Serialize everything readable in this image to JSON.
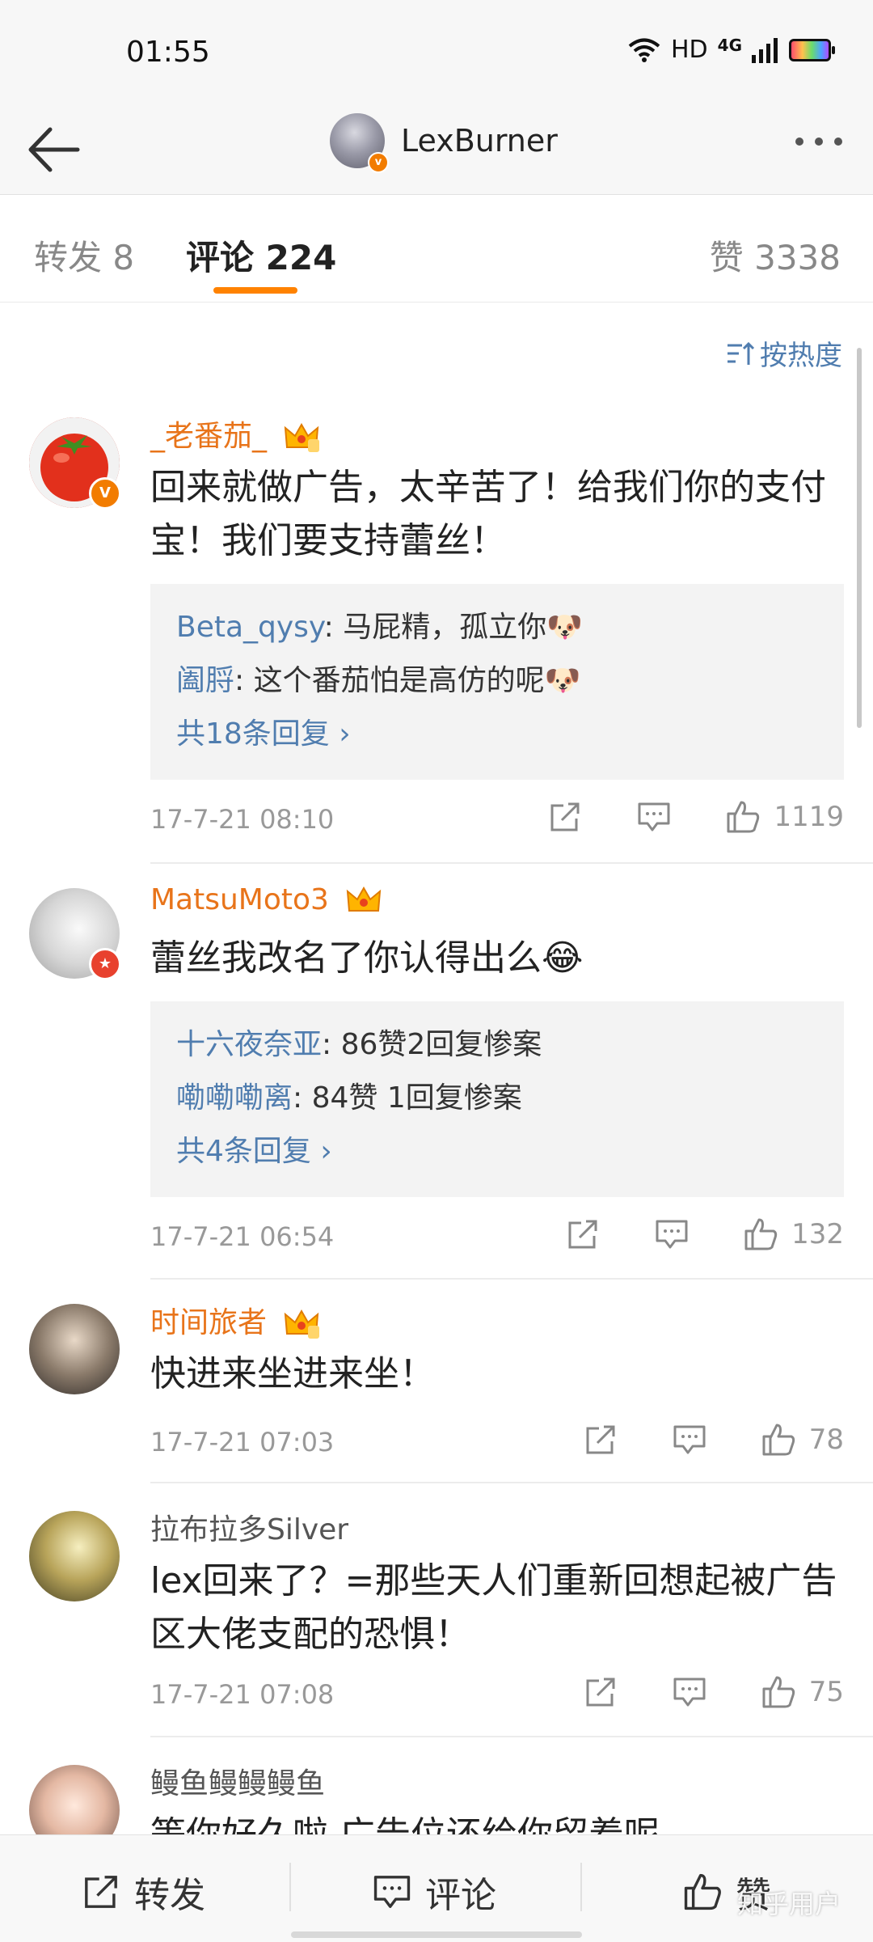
{
  "status_bar": {
    "time": "01:55",
    "hd": "HD",
    "network": "4G"
  },
  "header": {
    "title": "LexBurner",
    "verified": "v"
  },
  "tabs": {
    "repost": "转发 8",
    "comments": "评论 224",
    "likes": "赞 3338"
  },
  "sort_label": "按热度",
  "comments": [
    {
      "user": "_老番茄_",
      "text_line1": "回来就做广告，太辛苦了！给我们你的支付",
      "text_line2": "宝！我们要支持蕾丝！",
      "replies": [
        {
          "user": "Beta_qysy",
          "text": ": 马屁精，孤立你🐶"
        },
        {
          "user": "阖脟",
          "text": ": 这个番茄怕是高仿的呢🐶"
        }
      ],
      "more_replies": "共18条回复",
      "time": "17-7-21 08:10",
      "likes": "1119"
    },
    {
      "user": "MatsuMoto3",
      "text_line1": "蕾丝我改名了你认得出么😂",
      "replies": [
        {
          "user": "十六夜奈亚",
          "text": ": 86赞2回复惨案"
        },
        {
          "user": "嘞嘞嘞离",
          "text": ": 84赞 1回复惨案"
        }
      ],
      "more_replies": "共4条回复",
      "time": "17-7-21 06:54",
      "likes": "132"
    },
    {
      "user": "时间旅者",
      "text_line1": "快进来坐进来坐！",
      "time": "17-7-21 07:03",
      "likes": "78"
    },
    {
      "user": "拉布拉多Silver",
      "text_line1": "lex回来了？=那些天人们重新回想起被广告",
      "text_line2": "区大佬支配的恐惧！",
      "time": "17-7-21 07:08",
      "likes": "75"
    },
    {
      "user": "鳗鱼鳗鳗鳗鱼",
      "text_line1": "等你好久啦 广告位还给你留着呢"
    }
  ],
  "bottom_bar": {
    "repost": "转发",
    "comment": "评论",
    "like": "赞"
  },
  "watermark": "知乎用户",
  "colors": {
    "accent": "#ff8200",
    "link": "#507daf",
    "username": "#e8741a"
  }
}
